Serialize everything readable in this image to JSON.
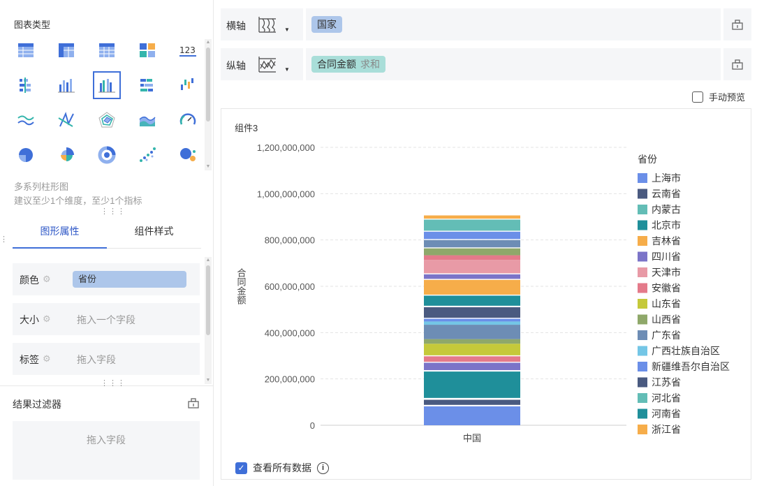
{
  "left_panel": {
    "chart_type_title": "图表类型",
    "chart_types": [
      {
        "name": "table-icon"
      },
      {
        "name": "cross-table-icon"
      },
      {
        "name": "detail-table-icon"
      },
      {
        "name": "dashboard-card-icon"
      },
      {
        "name": "indicator-card-icon",
        "text": "123"
      },
      {
        "name": "horizontal-bar-icon"
      },
      {
        "name": "column-icon"
      },
      {
        "name": "multi-series-column-icon"
      },
      {
        "name": "stacked-bar-icon"
      },
      {
        "name": "waterfall-icon"
      },
      {
        "name": "line-icon"
      },
      {
        "name": "radar-line-icon"
      },
      {
        "name": "radar-icon"
      },
      {
        "name": "area-icon"
      },
      {
        "name": "gauge-icon"
      },
      {
        "name": "pie-icon"
      },
      {
        "name": "rose-pie-icon"
      },
      {
        "name": "donut-icon"
      },
      {
        "name": "scatter-icon"
      },
      {
        "name": "bubble-icon"
      }
    ],
    "selected_index": 7,
    "chart_desc": "多系列柱形图",
    "chart_hint": "建议至少1个维度，至少1个指标",
    "tabs": [
      "图形属性",
      "组件样式"
    ],
    "active_tab": 0,
    "props": {
      "color_label": "颜色",
      "color_value": "省份",
      "size_label": "大小",
      "size_placeholder": "拖入一个字段",
      "label_label": "标签",
      "label_placeholder": "拖入字段"
    },
    "filter_title": "结果过滤器",
    "filter_placeholder": "拖入字段"
  },
  "axes": {
    "x_label": "横轴",
    "x_field": "国家",
    "y_label": "纵轴",
    "y_field": "合同金额",
    "y_agg": "求和"
  },
  "manual_preview": "手动预览",
  "component_title": "组件3",
  "view_all": "查看所有数据",
  "colors": {
    "accent": "#3f6fd8",
    "x_tag": "#adc6ea",
    "y_tag": "#a9ded9"
  },
  "chart_data": {
    "type": "bar",
    "stacked": true,
    "categories": [
      "中国"
    ],
    "ylabel": "合同金额",
    "xlabel": "",
    "ylim": [
      0,
      1200000000
    ],
    "yticks": [
      "0",
      "200,000,000",
      "400,000,000",
      "600,000,000",
      "800,000,000",
      "1,000,000,000",
      "1,200,000,000"
    ],
    "grid": true,
    "legend_title": "省份",
    "legend_position": "right",
    "legend": [
      {
        "name": "上海市",
        "color": "#6b8fe8"
      },
      {
        "name": "云南省",
        "color": "#4a5a80"
      },
      {
        "name": "内蒙古",
        "color": "#63bdb6"
      },
      {
        "name": "北京市",
        "color": "#1f8f9a"
      },
      {
        "name": "吉林省",
        "color": "#f6ad4a"
      },
      {
        "name": "四川省",
        "color": "#7b74c8"
      },
      {
        "name": "天津市",
        "color": "#e89aa6"
      },
      {
        "name": "安徽省",
        "color": "#e47a8a"
      },
      {
        "name": "山东省",
        "color": "#c5c93a"
      },
      {
        "name": "山西省",
        "color": "#8fa86a"
      },
      {
        "name": "广东省",
        "color": "#6d8db5"
      },
      {
        "name": "广西壮族自治区",
        "color": "#74c6e6"
      },
      {
        "name": "新疆维吾尔自治区",
        "color": "#6b8fe8"
      },
      {
        "name": "江苏省",
        "color": "#4a5a80"
      },
      {
        "name": "河北省",
        "color": "#63bdb6"
      },
      {
        "name": "河南省",
        "color": "#1f8f9a"
      },
      {
        "name": "浙江省",
        "color": "#f6ad4a"
      }
    ],
    "segments": [
      {
        "value": 82000000,
        "color": "#6b8fe8"
      },
      {
        "value": 6000000,
        "color": "#ffffff"
      },
      {
        "value": 22000000,
        "color": "#4a5a80"
      },
      {
        "value": 8000000,
        "color": "#ffffff"
      },
      {
        "value": 114000000,
        "color": "#1f8f9a"
      },
      {
        "value": 6000000,
        "color": "#ffffff"
      },
      {
        "value": 32000000,
        "color": "#7b74c8"
      },
      {
        "value": 4000000,
        "color": "#ffffff"
      },
      {
        "value": 24000000,
        "color": "#e47a8a"
      },
      {
        "value": 4000000,
        "color": "#ffffff"
      },
      {
        "value": 50000000,
        "color": "#c5c93a"
      },
      {
        "value": 20000000,
        "color": "#8fa86a"
      },
      {
        "value": 62000000,
        "color": "#6d8db5"
      },
      {
        "value": 14000000,
        "color": "#74c6e6"
      },
      {
        "value": 12000000,
        "color": "#6b8fe8"
      },
      {
        "value": 4000000,
        "color": "#ffffff"
      },
      {
        "value": 46000000,
        "color": "#4a5a80"
      },
      {
        "value": 6000000,
        "color": "#ffffff"
      },
      {
        "value": 44000000,
        "color": "#1f8f9a"
      },
      {
        "value": 4000000,
        "color": "#ffffff"
      },
      {
        "value": 64000000,
        "color": "#f6ad4a"
      },
      {
        "value": 4000000,
        "color": "#ffffff"
      },
      {
        "value": 20000000,
        "color": "#7b74c8"
      },
      {
        "value": 4000000,
        "color": "#ffffff"
      },
      {
        "value": 58000000,
        "color": "#e89aa6"
      },
      {
        "value": 20000000,
        "color": "#e47a8a"
      },
      {
        "value": 30000000,
        "color": "#8fa86a"
      },
      {
        "value": 4000000,
        "color": "#ffffff"
      },
      {
        "value": 32000000,
        "color": "#6d8db5"
      },
      {
        "value": 4000000,
        "color": "#ffffff"
      },
      {
        "value": 32000000,
        "color": "#6b8fe8"
      },
      {
        "value": 4000000,
        "color": "#ffffff"
      },
      {
        "value": 48000000,
        "color": "#63bdb6"
      },
      {
        "value": 4000000,
        "color": "#ffffff"
      },
      {
        "value": 14000000,
        "color": "#f6ad4a"
      }
    ]
  }
}
